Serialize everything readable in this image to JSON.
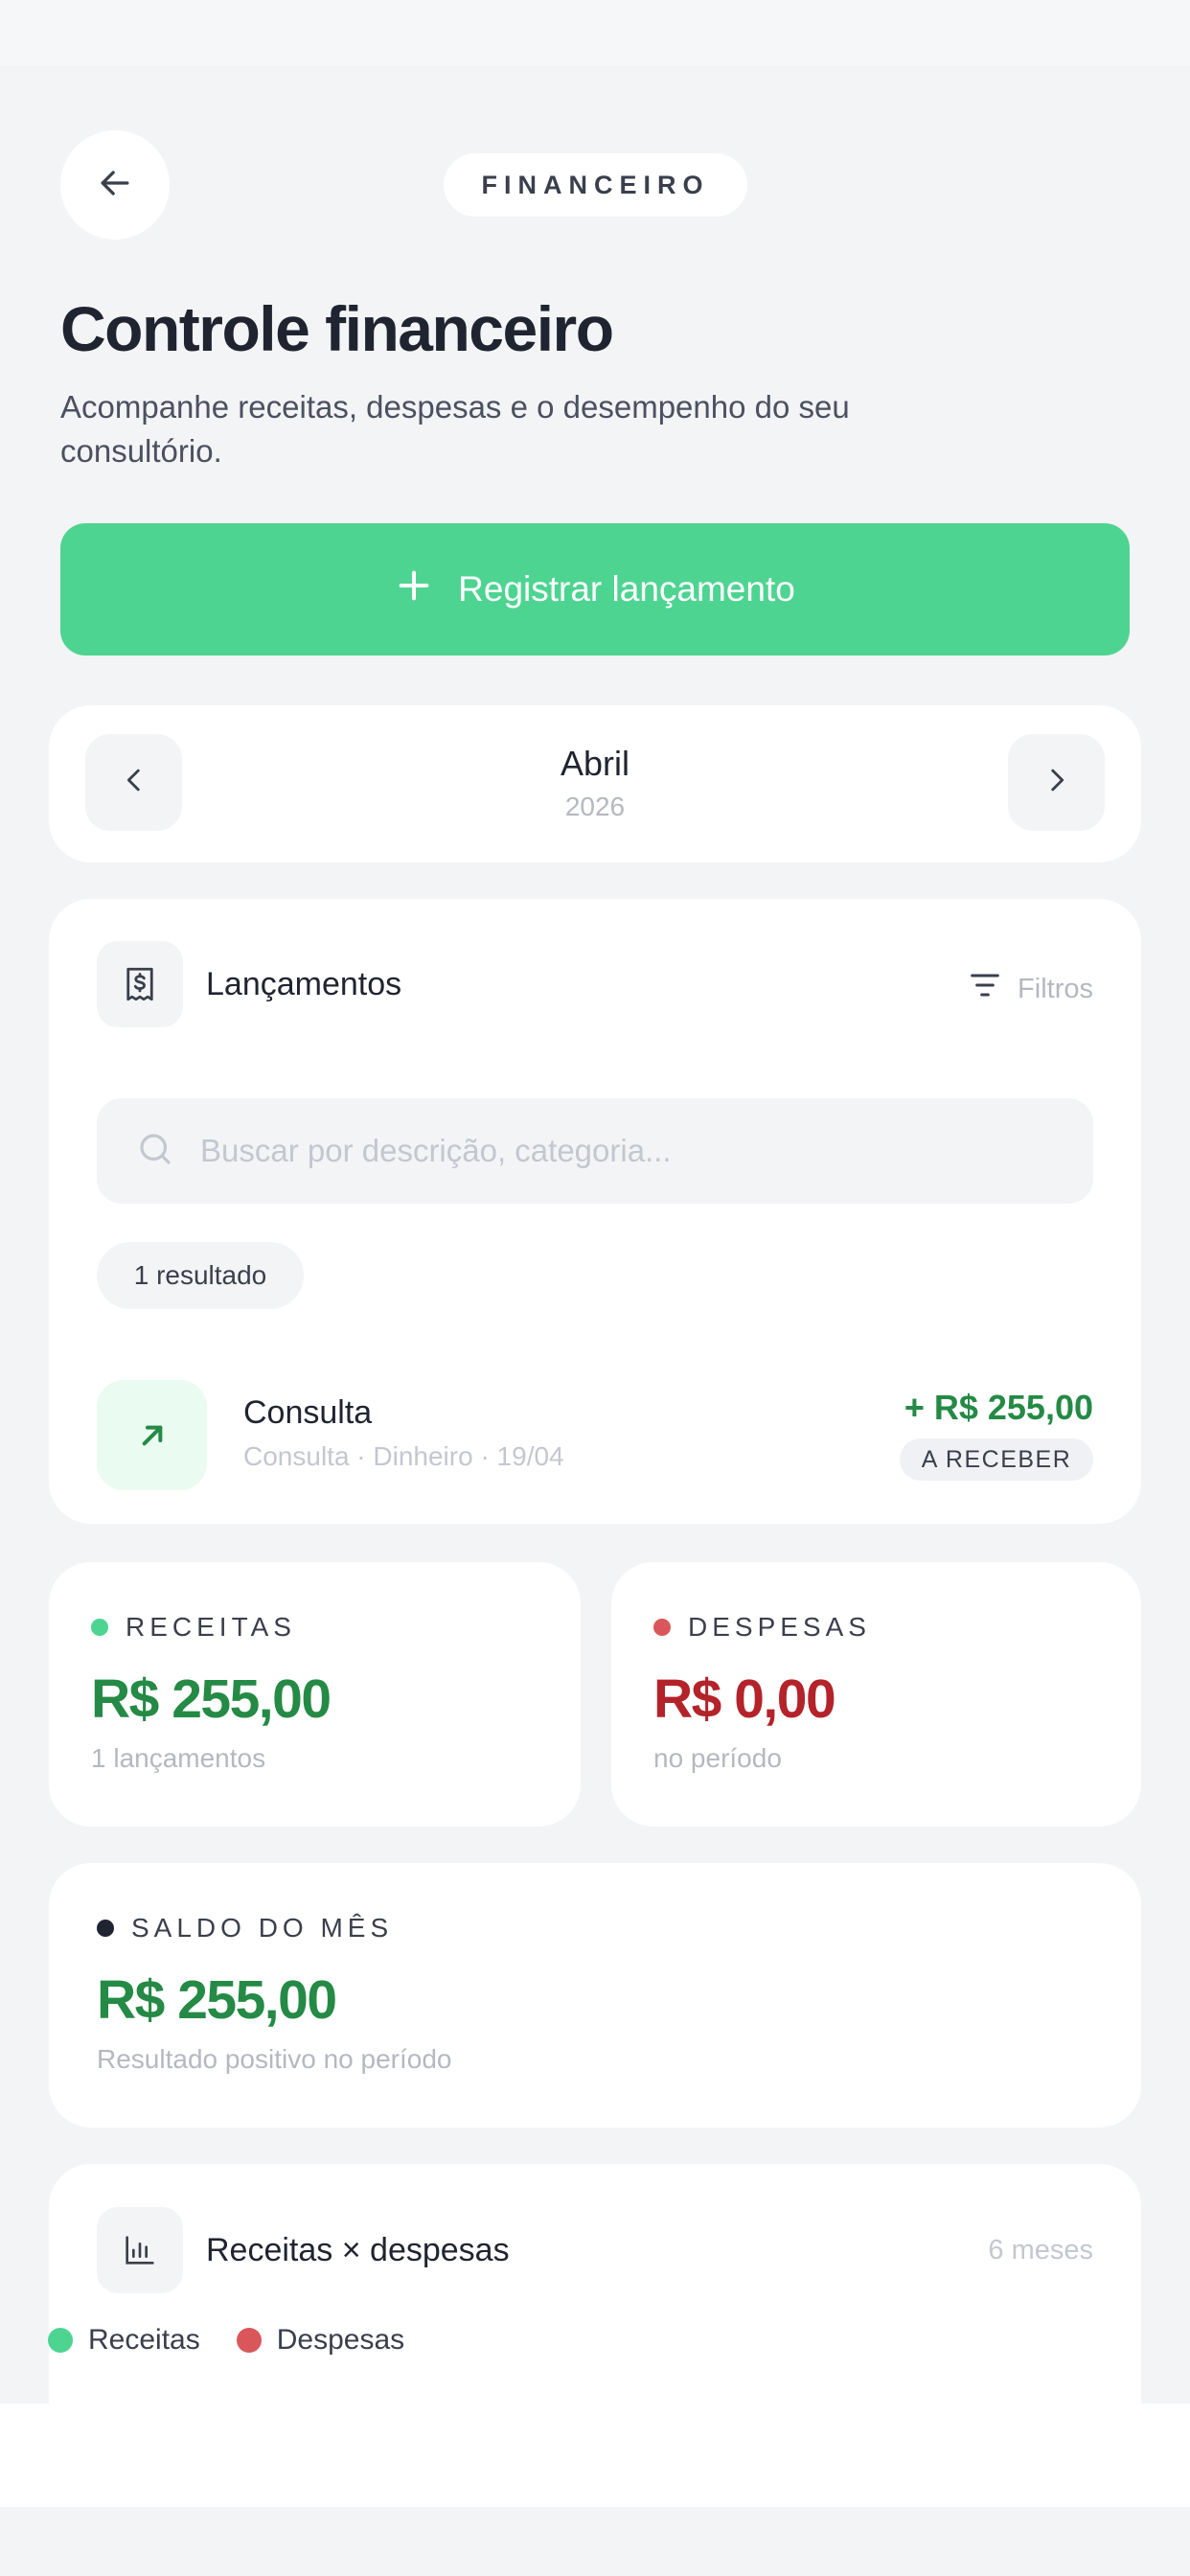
{
  "header": {
    "back_icon": "arrow-left-icon",
    "section": "FINANCEIRO",
    "title": "Controle financeiro",
    "subtitle": "Acompanhe receitas, despesas e o desempenho do seu consultório."
  },
  "primary_action": {
    "icon": "plus-icon",
    "label": "Registrar lançamento"
  },
  "period": {
    "month": "Abril",
    "year": "2026"
  },
  "entries": {
    "icon": "receipt-dollar-icon",
    "title": "Lançamentos",
    "filter_label": "Filtros",
    "search_placeholder": "Buscar por descrição, categoria...",
    "result_count": "1 resultado",
    "items": [
      {
        "icon": "arrow-up-right-icon",
        "title": "Consulta",
        "meta": "Consulta · Dinheiro · 19/04",
        "amount": "+ R$ 255,00",
        "status": "A RECEBER"
      }
    ]
  },
  "income": {
    "label": "RECEITAS",
    "value": "R$ 255,00",
    "sub": "1 lançamentos",
    "color": "#248a45",
    "dot_color": "#4ed491"
  },
  "expenses": {
    "label": "DESPESAS",
    "value": "R$ 0,00",
    "sub": "no período",
    "color": "#b4232a",
    "dot_color": "#d9575a"
  },
  "balance": {
    "label": "SALDO DO MÊS",
    "value": "R$ 255,00",
    "sub": "Resultado positivo no período",
    "color": "#248a45",
    "dot_color": "#1f2430"
  },
  "chart_panel": {
    "icon": "bar-chart-icon",
    "title": "Receitas × despesas",
    "range": "6 meses",
    "legend": [
      "Receitas",
      "Despesas"
    ]
  }
}
